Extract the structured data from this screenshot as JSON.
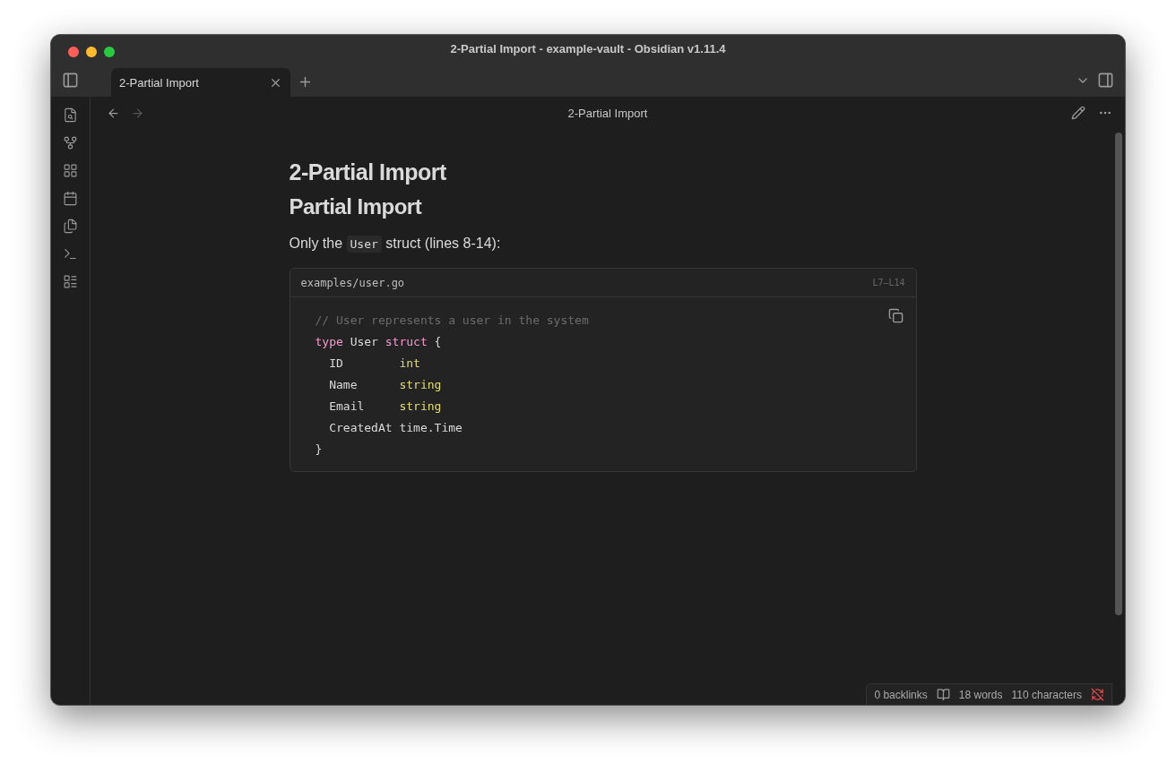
{
  "window": {
    "title": "2-Partial Import - example-vault - Obsidian v1.11.4"
  },
  "tabs": [
    {
      "label": "2-Partial Import",
      "selected": true
    }
  ],
  "view_header": {
    "title": "2-Partial Import"
  },
  "note": {
    "heading1": "2-Partial Import",
    "heading2": "Partial Import",
    "paragraph": [
      {
        "kind": "text",
        "text": "Only the "
      },
      {
        "kind": "code",
        "text": "User"
      },
      {
        "kind": "text",
        "text": " struct (lines 8-14):"
      }
    ],
    "code_block": {
      "filename": "examples/user.go",
      "range": "L7–L14",
      "lines": [
        [
          {
            "kind": "comment",
            "text": "// User represents a user in the system"
          }
        ],
        [
          {
            "kind": "keyword",
            "text": "type"
          },
          {
            "kind": "plain",
            "text": " User "
          },
          {
            "kind": "keyword",
            "text": "struct"
          },
          {
            "kind": "plain",
            "text": " {"
          }
        ],
        [
          {
            "kind": "plain",
            "text": "  ID        "
          },
          {
            "kind": "type",
            "text": "int"
          }
        ],
        [
          {
            "kind": "plain",
            "text": "  Name      "
          },
          {
            "kind": "type",
            "text": "string"
          }
        ],
        [
          {
            "kind": "plain",
            "text": "  Email     "
          },
          {
            "kind": "type",
            "text": "string"
          }
        ],
        [
          {
            "kind": "plain",
            "text": "  CreatedAt time.Time"
          }
        ],
        [
          {
            "kind": "plain",
            "text": "}"
          }
        ]
      ]
    }
  },
  "status_bar": {
    "backlinks": "0 backlinks",
    "words": "18 words",
    "characters": "110 characters"
  }
}
